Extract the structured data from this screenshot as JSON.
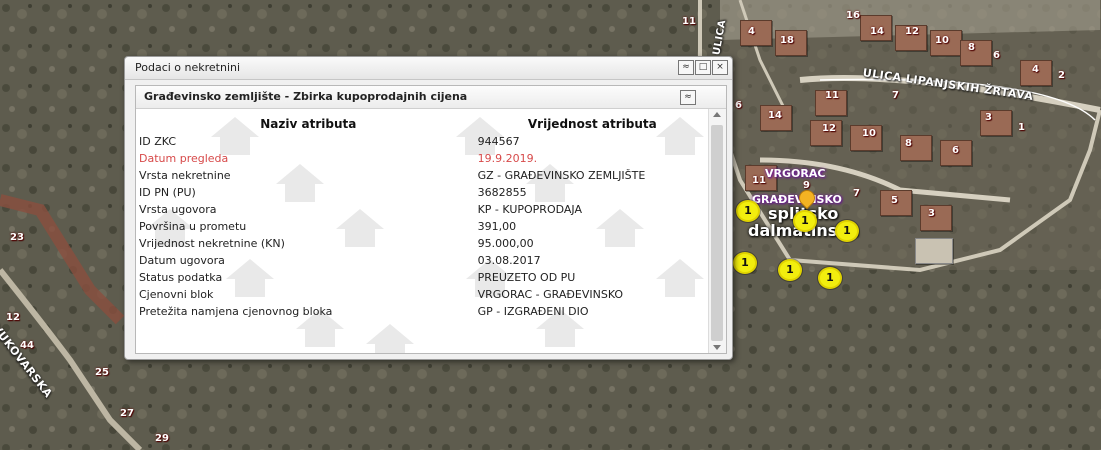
{
  "map": {
    "street_labels": [
      "ULICA LIPANJSKIH ŽRTAVA",
      "ULICA",
      "VUKOVARSKA"
    ],
    "region_labels": [
      "VRGORAC",
      "GRAĐEVINSKO",
      "splitsko",
      "dalmatinska"
    ],
    "house_numbers": [
      "11",
      "4",
      "18",
      "16",
      "14",
      "12",
      "10",
      "8",
      "6",
      "4",
      "2",
      "6",
      "11",
      "7",
      "14",
      "12",
      "10",
      "8",
      "3",
      "1",
      "6",
      "11",
      "9",
      "7",
      "5",
      "3",
      "23",
      "12",
      "44",
      "25",
      "27",
      "29"
    ],
    "cluster_counts": [
      "1",
      "1",
      "1",
      "1",
      "1",
      "1"
    ]
  },
  "panel": {
    "title": "Podaci o nekretnini",
    "buttons": [
      "≈",
      "□",
      "×"
    ],
    "section_title": "Građevinsko zemljište - Zbirka kupoprodajnih cijena",
    "section_button": "≈",
    "headers": {
      "attribute": "Naziv atributa",
      "value": "Vrijednost atributa"
    },
    "rows": [
      {
        "attribute": "ID ZKC",
        "value": "944567"
      },
      {
        "attribute": "Datum pregleda",
        "value": "19.9.2019."
      },
      {
        "attribute": "Vrsta nekretnine",
        "value": "GZ - GRAĐEVINSKO ZEMLJIŠTE"
      },
      {
        "attribute": "ID PN (PU)",
        "value": "3682855"
      },
      {
        "attribute": "Vrsta ugovora",
        "value": "KP - KUPOPRODAJA"
      },
      {
        "attribute": "Površina u prometu",
        "value": "391,00"
      },
      {
        "attribute": "Vrijednost nekretnine (KN)",
        "value": "95.000,00"
      },
      {
        "attribute": "Datum ugovora",
        "value": "03.08.2017"
      },
      {
        "attribute": "Status podatka",
        "value": "PREUZETO OD PU"
      },
      {
        "attribute": "Cjenovni blok",
        "value": "VRGORAC - GRAĐEVINSKO"
      },
      {
        "attribute": "Pretežita namjena cjenovnog bloka",
        "value": "GP - IZGRAĐENI DIO"
      }
    ],
    "highlight_color": "#d74a4a"
  }
}
